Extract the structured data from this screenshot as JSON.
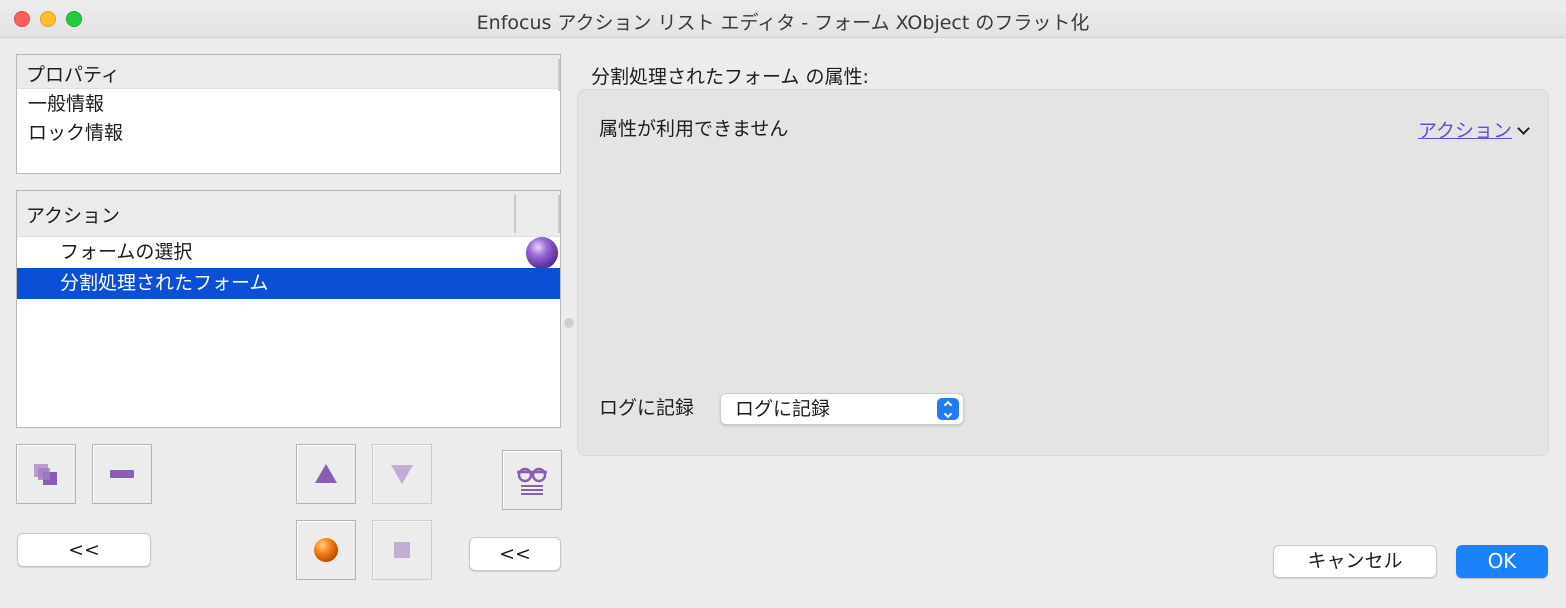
{
  "window": {
    "title": "Enfocus アクション リスト エディタ - フォーム XObject のフラット化"
  },
  "properties_panel": {
    "header": "プロパティ",
    "items": [
      "一般情報",
      "ロック情報"
    ]
  },
  "actions_panel": {
    "header": "アクション",
    "items": [
      {
        "label": "フォームの選択",
        "selected": false,
        "has_icon": true
      },
      {
        "label": "分割処理されたフォーム",
        "selected": true,
        "has_icon": false
      }
    ]
  },
  "buttons": {
    "collapse_left": "<<",
    "collapse_right": "<<",
    "cancel": "キャンセル",
    "ok": "OK"
  },
  "attributes": {
    "label": "分割処理されたフォーム の属性:",
    "message": "属性が利用できません",
    "action_menu": "アクション",
    "log_label": "ログに記録",
    "log_value": "ログに記録"
  },
  "colors": {
    "selection": "#0a4fd6",
    "accent": "#1a82fb",
    "link": "#5b4fd9"
  }
}
